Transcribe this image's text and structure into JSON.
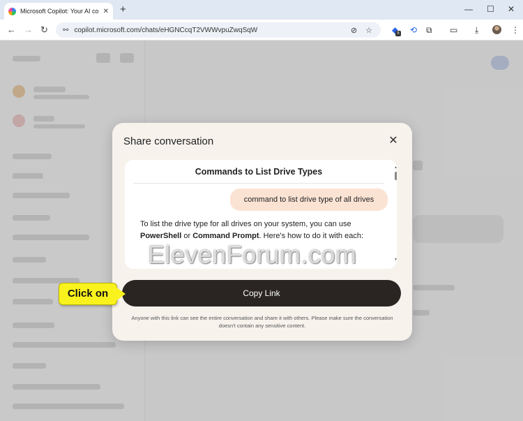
{
  "browser": {
    "tab_title": "Microsoft Copilot: Your AI com",
    "tab_close": "✕",
    "new_tab": "+",
    "url": "copilot.microsoft.com/chats/eHGNCcqT2VWWvpuZwqSqW",
    "extension_badge": "5",
    "icons": {
      "back": "←",
      "forward": "→",
      "reload": "↻",
      "site_info": "⚯",
      "eye_off": "⊘",
      "star": "☆",
      "extensions": "⧉",
      "tab_search": "▭",
      "download": "⤓",
      "menu": "⋮",
      "minimize": "—",
      "maximize": "☐",
      "close": "✕"
    }
  },
  "modal": {
    "title": "Share conversation",
    "close_icon": "✕",
    "preview": {
      "title": "Commands to List Drive Types",
      "user_message": "command to list drive type of all drives",
      "reply_pre": "To list the drive type for all drives on your system, you can use ",
      "reply_bold1": "PowerShell",
      "reply_mid": " or ",
      "reply_bold2": "Command Prompt",
      "reply_post": ". Here's how to do it with each:"
    },
    "copy_button": "Copy Link",
    "disclaimer": "Anyone with this link can see the entire conversation and share it with others. Please make sure the conversation doesn't contain any sensitive content."
  },
  "callout": {
    "label": "Click on",
    "color": "#f9f21d"
  },
  "watermark": "ElevenForum.com",
  "colors": {
    "modal_bg": "#f7f2ec",
    "button_bg": "#2a2522",
    "user_bubble": "#fbe3d4"
  }
}
